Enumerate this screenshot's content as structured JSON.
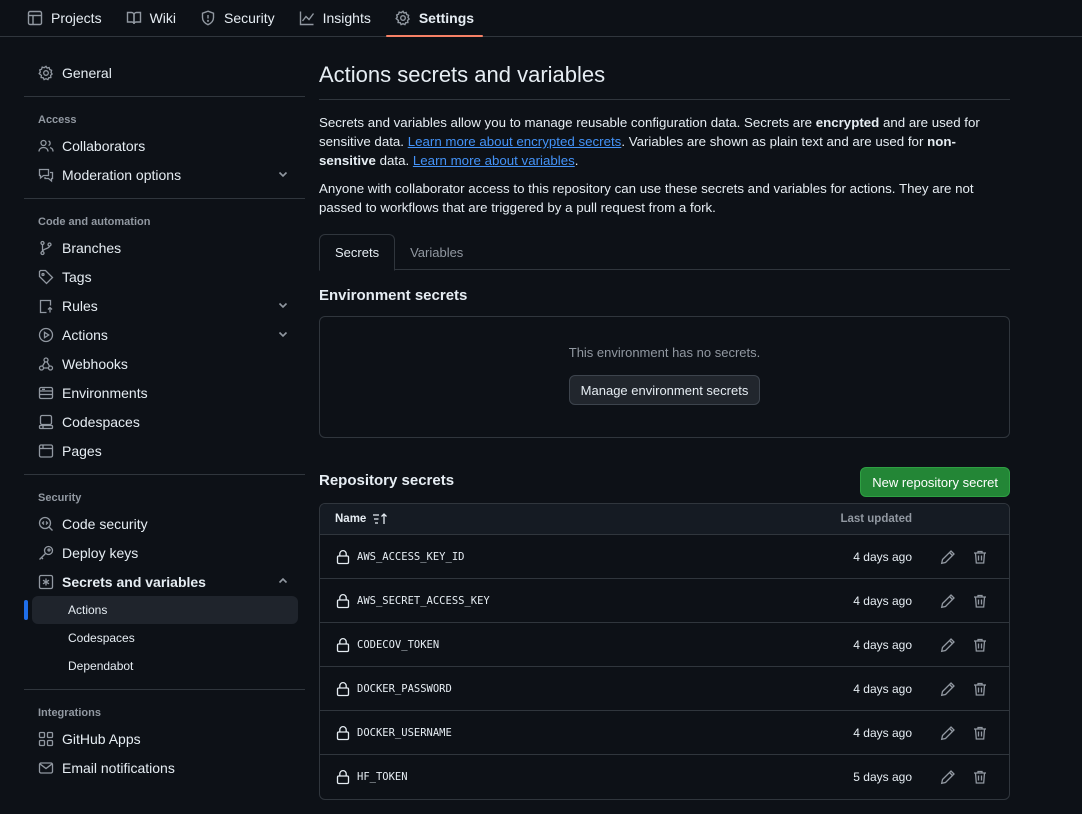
{
  "topnav": {
    "tabs": [
      {
        "label": "Projects",
        "icon": "table-icon"
      },
      {
        "label": "Wiki",
        "icon": "book-icon"
      },
      {
        "label": "Security",
        "icon": "shield-icon"
      },
      {
        "label": "Insights",
        "icon": "graph-icon"
      },
      {
        "label": "Settings",
        "icon": "gear-icon",
        "active": true
      }
    ]
  },
  "sidebar": {
    "general": "General",
    "access_heading": "Access",
    "collaborators": "Collaborators",
    "moderation": "Moderation options",
    "code_heading": "Code and automation",
    "branches": "Branches",
    "tags": "Tags",
    "rules": "Rules",
    "actions": "Actions",
    "webhooks": "Webhooks",
    "environments": "Environments",
    "codespaces": "Codespaces",
    "pages": "Pages",
    "security_heading": "Security",
    "code_security": "Code security",
    "deploy_keys": "Deploy keys",
    "secrets_vars": "Secrets and variables",
    "sub_actions": "Actions",
    "sub_codespaces": "Codespaces",
    "sub_dependabot": "Dependabot",
    "integrations_heading": "Integrations",
    "github_apps": "GitHub Apps",
    "email_notifications": "Email notifications"
  },
  "main": {
    "title": "Actions secrets and variables",
    "p1_a": "Secrets and variables allow you to manage reusable configuration data. Secrets are ",
    "p1_b": "encrypted",
    "p1_c": " and are used for sensitive data. ",
    "p1_link1": "Learn more about encrypted secrets",
    "p1_d": ". Variables are shown as plain text and are used for ",
    "p1_e": "non-sensitive",
    "p1_f": " data. ",
    "p1_link2": "Learn more about variables",
    "p1_g": ".",
    "p2": "Anyone with collaborator access to this repository can use these secrets and variables for actions. They are not passed to workflows that are triggered by a pull request from a fork.",
    "tab_secrets": "Secrets",
    "tab_variables": "Variables",
    "env_title": "Environment secrets",
    "env_empty": "This environment has no secrets.",
    "env_button": "Manage environment secrets",
    "repo_title": "Repository secrets",
    "new_button": "New repository secret",
    "col_name": "Name",
    "col_updated": "Last updated",
    "secrets": [
      {
        "name": "AWS_ACCESS_KEY_ID",
        "updated": "4 days ago"
      },
      {
        "name": "AWS_SECRET_ACCESS_KEY",
        "updated": "4 days ago"
      },
      {
        "name": "CODECOV_TOKEN",
        "updated": "4 days ago"
      },
      {
        "name": "DOCKER_PASSWORD",
        "updated": "4 days ago"
      },
      {
        "name": "DOCKER_USERNAME",
        "updated": "4 days ago"
      },
      {
        "name": "HF_TOKEN",
        "updated": "5 days ago"
      }
    ]
  },
  "colors": {
    "background": "#0d1117",
    "border": "#30363d",
    "link": "#4493f8",
    "primary_button": "#238636",
    "active_underline": "#f78166",
    "active_indicator": "#1f6feb"
  }
}
